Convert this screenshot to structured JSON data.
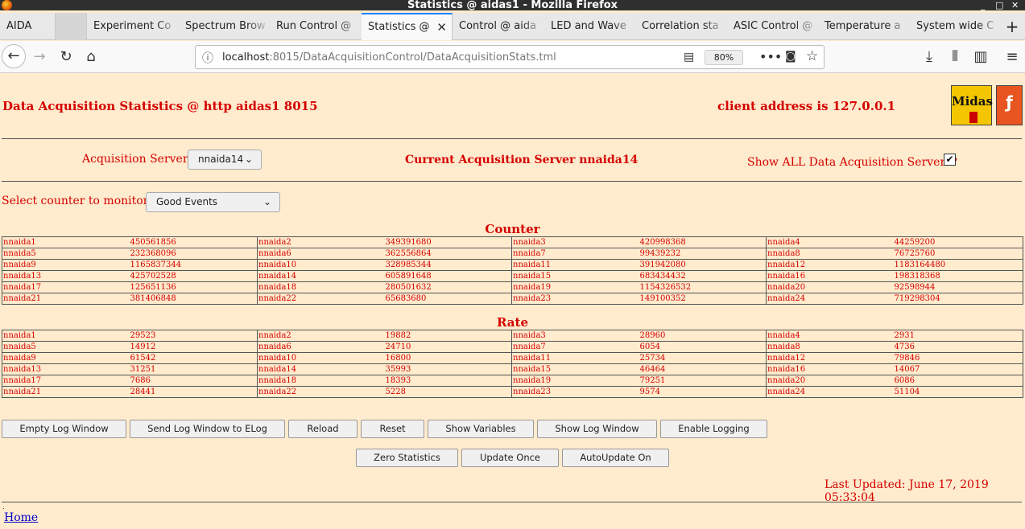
{
  "window": {
    "title": "Statistics @ aidas1 - Mozilla Firefox"
  },
  "tabs": [
    {
      "label": "AIDA"
    },
    {
      "label": ""
    },
    {
      "label": "Experiment Co"
    },
    {
      "label": "Spectrum Brow"
    },
    {
      "label": "Run Control @"
    },
    {
      "label": "Statistics @"
    },
    {
      "label": "Control @ aida"
    },
    {
      "label": "LED and Wave"
    },
    {
      "label": "Correlation sta"
    },
    {
      "label": "ASIC Control @"
    },
    {
      "label": "Temperature a"
    },
    {
      "label": "System wide C"
    }
  ],
  "navbar": {
    "url_host": "localhost",
    "url_rest": ":8015/DataAcquisitionControl/DataAcquisitionStats.tml",
    "zoom": "80%"
  },
  "page": {
    "title": "Data Acquisition Statistics @ http aidas1 8015",
    "client_address": "client address is 127.0.0.1",
    "midas_logo_text": "Midas",
    "acq_servers_label": "Acquisition Servers",
    "acq_server_selected": "nnaida14",
    "current_server": "Current Acquisition Server nnaida14",
    "show_all_label": "Show ALL Data Acquisition Servers?",
    "show_all_checked": true,
    "counter_label": "Select counter to monitor",
    "counter_selected": "Good Events",
    "counter_title": "Counter",
    "rate_title": "Rate",
    "last_updated": "Last Updated: June 17, 2019 05:33:04",
    "home_link": "Home"
  },
  "counter_rows": [
    [
      [
        "nnaida1",
        "450561856"
      ],
      [
        "nnaida2",
        "349391680"
      ],
      [
        "nnaida3",
        "420998368"
      ],
      [
        "nnaida4",
        "44259200"
      ]
    ],
    [
      [
        "nnaida5",
        "232368096"
      ],
      [
        "nnaida6",
        "362556864"
      ],
      [
        "nnaida7",
        "99439232"
      ],
      [
        "nnaida8",
        "76725760"
      ]
    ],
    [
      [
        "nnaida9",
        "1165837344"
      ],
      [
        "nnaida10",
        "328985344"
      ],
      [
        "nnaida11",
        "391942080"
      ],
      [
        "nnaida12",
        "1183164480"
      ]
    ],
    [
      [
        "nnaida13",
        "425702528"
      ],
      [
        "nnaida14",
        "605891648"
      ],
      [
        "nnaida15",
        "683434432"
      ],
      [
        "nnaida16",
        "198318368"
      ]
    ],
    [
      [
        "nnaida17",
        "125651136"
      ],
      [
        "nnaida18",
        "280501632"
      ],
      [
        "nnaida19",
        "1154326532"
      ],
      [
        "nnaida20",
        "92598944"
      ]
    ],
    [
      [
        "nnaida21",
        "381406848"
      ],
      [
        "nnaida22",
        "65683680"
      ],
      [
        "nnaida23",
        "149100352"
      ],
      [
        "nnaida24",
        "719298304"
      ]
    ]
  ],
  "rate_rows": [
    [
      [
        "nnaida1",
        "29523"
      ],
      [
        "nnaida2",
        "19882"
      ],
      [
        "nnaida3",
        "28960"
      ],
      [
        "nnaida4",
        "2931"
      ]
    ],
    [
      [
        "nnaida5",
        "14912"
      ],
      [
        "nnaida6",
        "24710"
      ],
      [
        "nnaida7",
        "6054"
      ],
      [
        "nnaida8",
        "4736"
      ]
    ],
    [
      [
        "nnaida9",
        "61542"
      ],
      [
        "nnaida10",
        "16800"
      ],
      [
        "nnaida11",
        "25734"
      ],
      [
        "nnaida12",
        "79846"
      ]
    ],
    [
      [
        "nnaida13",
        "31251"
      ],
      [
        "nnaida14",
        "35993"
      ],
      [
        "nnaida15",
        "46464"
      ],
      [
        "nnaida16",
        "14067"
      ]
    ],
    [
      [
        "nnaida17",
        "7686"
      ],
      [
        "nnaida18",
        "18393"
      ],
      [
        "nnaida19",
        "79251"
      ],
      [
        "nnaida20",
        "6086"
      ]
    ],
    [
      [
        "nnaida21",
        "28441"
      ],
      [
        "nnaida22",
        "5228"
      ],
      [
        "nnaida23",
        "9574"
      ],
      [
        "nnaida24",
        "51104"
      ]
    ]
  ],
  "buttons": {
    "empty_log": "Empty Log Window",
    "send_log": "Send Log Window to ELog",
    "reload": "Reload",
    "reset": "Reset",
    "show_variables": "Show Variables",
    "show_log": "Show Log Window",
    "enable_logging": "Enable Logging",
    "zero_statistics": "Zero Statistics",
    "update_once": "Update Once",
    "autoupdate": "AutoUpdate On"
  },
  "colors": {
    "page_background": "#ffebcd",
    "text_red": "#d40000",
    "link_blue": "#0000cc"
  }
}
